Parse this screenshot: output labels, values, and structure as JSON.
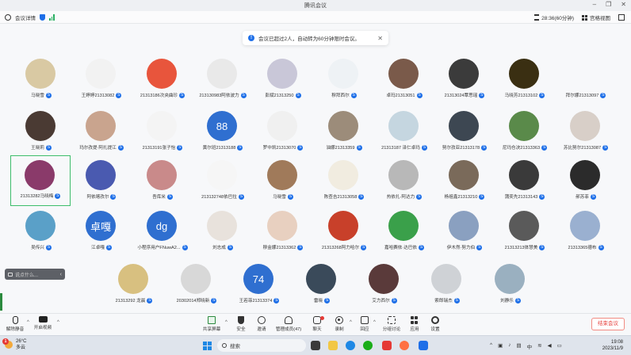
{
  "window": {
    "title": "腾讯会议"
  },
  "header": {
    "meeting_info": "会议详情",
    "timer": "28:36(60分钟)",
    "view_mode": "宫格视图"
  },
  "notice": {
    "text": "会议已超过2人，自动转为60分钟限时会议。"
  },
  "participants": [
    {
      "name": "马晓雪",
      "avatar_text": "",
      "color": "#d9c9a3",
      "active": false
    },
    {
      "name": "王婷婷21313082",
      "avatar_text": "",
      "color": "#f2f2f2",
      "active": false
    },
    {
      "name": "21313186次央曲珍",
      "avatar_text": "",
      "color": "#e8553c",
      "active": false
    },
    {
      "name": "213130983阿依波力",
      "avatar_text": "",
      "color": "#e9e9e9",
      "active": false
    },
    {
      "name": "彭斌21313250",
      "avatar_text": "",
      "color": "#c9c7d8",
      "active": false
    },
    {
      "name": "穆拜西尔",
      "avatar_text": "",
      "color": "#eef2f5",
      "active": false
    },
    {
      "name": "卓玛21313051",
      "avatar_text": "",
      "color": "#7a5a4a",
      "active": false
    },
    {
      "name": "21313024覃思瑶",
      "avatar_text": "",
      "color": "#3b3b3b",
      "active": false
    },
    {
      "name": "马晓芳21313102",
      "avatar_text": "",
      "color": "#3a2f12",
      "active": false
    },
    {
      "name": "拜尔娜21313097",
      "avatar_text": "",
      "color": "#f7f8fa",
      "active": false
    },
    {
      "name": "王晓莉",
      "avatar_text": "",
      "color": "#4a3a33",
      "active": false
    },
    {
      "name": "玛尔孜提·阿扎提江",
      "avatar_text": "",
      "color": "#c9a48e",
      "active": false
    },
    {
      "name": "21313191张子怡",
      "avatar_text": "",
      "color": "#f4f4f4",
      "active": false
    },
    {
      "name": "黄尔班21313188",
      "avatar_text": "88",
      "color": "#2f6fd0",
      "active": false
    },
    {
      "name": "罗中凯21313070",
      "avatar_text": "",
      "color": "#f0f0f0",
      "active": false
    },
    {
      "name": "油娜21313359",
      "avatar_text": "",
      "color": "#9c8c7a",
      "active": false
    },
    {
      "name": "21313187 泽仁卓玛",
      "avatar_text": "",
      "color": "#c5d6e0",
      "active": false
    },
    {
      "name": "努尔孜亚21313178",
      "avatar_text": "",
      "color": "#3d4752",
      "active": false
    },
    {
      "name": "尼玛仓决21313363",
      "avatar_text": "",
      "color": "#5a8a4a",
      "active": false
    },
    {
      "name": "苏比努尔21313087",
      "avatar_text": "",
      "color": "#d8cfc8",
      "active": false
    },
    {
      "name": "21313282马晓梅",
      "avatar_text": "",
      "color": "#8a3a6a",
      "active": true
    },
    {
      "name": "阿依喀孜尔",
      "avatar_text": "",
      "color": "#4a5ab0",
      "active": false
    },
    {
      "name": "吾库米",
      "avatar_text": "",
      "color": "#c98a8a",
      "active": false
    },
    {
      "name": "213132748依巴拉",
      "avatar_text": "",
      "color": "#f6f6f6",
      "active": false
    },
    {
      "name": "马晓雪",
      "avatar_text": "",
      "color": "#a07a5a",
      "active": false
    },
    {
      "name": "陈查吉21313058",
      "avatar_text": "",
      "color": "#f1ece0",
      "active": false
    },
    {
      "name": "热依扎·阿达力",
      "avatar_text": "",
      "color": "#b8b8b8",
      "active": false
    },
    {
      "name": "杨祖鑫21313210",
      "avatar_text": "",
      "color": "#7a6a5a",
      "active": false
    },
    {
      "name": "蒲奕先21313143",
      "avatar_text": "",
      "color": "#3a3a3a",
      "active": false
    },
    {
      "name": "郝苏菲",
      "avatar_text": "",
      "color": "#2b2b2b",
      "active": false
    },
    {
      "name": "吴传兴",
      "avatar_text": "",
      "color": "#5aa0c8",
      "active": false
    },
    {
      "name": "江卓嘎",
      "avatar_text": "卓嘎",
      "color": "#2f6fd0",
      "active": false
    },
    {
      "name": "小程序用户FNuwA2...",
      "avatar_text": "dg",
      "color": "#2f6fd0",
      "active": false
    },
    {
      "name": "刘志成",
      "avatar_text": "",
      "color": "#e8e2dc",
      "active": false
    },
    {
      "name": "穆金娜21313362",
      "avatar_text": "",
      "color": "#e8d0c0",
      "active": false
    },
    {
      "name": "21313268阿力哈尔",
      "avatar_text": "",
      "color": "#c8402a",
      "active": false
    },
    {
      "name": "嘉哈赛依·达巴依",
      "avatar_text": "",
      "color": "#3aa04a",
      "active": false
    },
    {
      "name": "伊木然·努力伯",
      "avatar_text": "",
      "color": "#8aa0c0",
      "active": false
    },
    {
      "name": "21313213体慧美",
      "avatar_text": "",
      "color": "#5a5a5a",
      "active": false
    },
    {
      "name": "21313365德布",
      "avatar_text": "",
      "color": "#9ab0d0",
      "active": false
    },
    {
      "name": "21313292 龙晨",
      "avatar_text": "",
      "color": "#d8c080",
      "active": false
    },
    {
      "name": "20302014郑晓新",
      "avatar_text": "",
      "color": "#d8d8d8",
      "active": false
    },
    {
      "name": "王若菲21313374",
      "avatar_text": "74",
      "color": "#2f6fd0",
      "active": false
    },
    {
      "name": "雷晓",
      "avatar_text": "",
      "color": "#3a4a5a",
      "active": false
    },
    {
      "name": "艾力西尔",
      "avatar_text": "",
      "color": "#5a3a3a",
      "active": false
    },
    {
      "name": "索郎瑞杰",
      "avatar_text": "",
      "color": "#cfd2d6",
      "active": false
    },
    {
      "name": "刘静乐",
      "avatar_text": "",
      "color": "#9ab0c0",
      "active": false
    }
  ],
  "chat": {
    "placeholder": "说点什么..."
  },
  "toolbar": {
    "items": [
      {
        "label": "解除静音"
      },
      {
        "label": "开启视频"
      },
      {
        "label": "共享屏幕"
      },
      {
        "label": "安全"
      },
      {
        "label": "邀请"
      },
      {
        "label": "管理成员(47)"
      },
      {
        "label": "聊天"
      },
      {
        "label": "录制"
      },
      {
        "label": "回应"
      },
      {
        "label": "分组讨论"
      },
      {
        "label": "应用"
      },
      {
        "label": "设置"
      }
    ],
    "end_label": "结束会议"
  },
  "taskbar": {
    "weather_temp": "26°C",
    "weather_desc": "多云",
    "weather_badge": "1",
    "search_label": "搜索",
    "time": "19:08",
    "date": "2023/11/9",
    "lang": "中"
  }
}
